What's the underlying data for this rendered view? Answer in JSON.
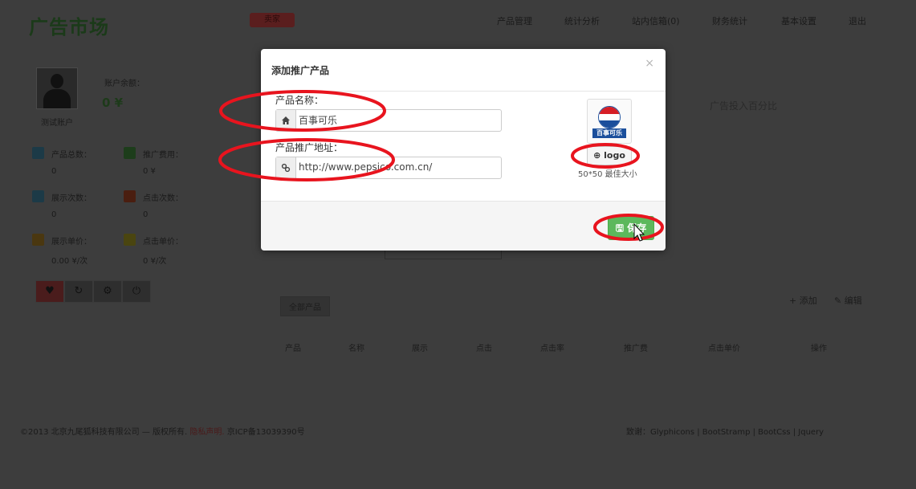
{
  "header": {
    "logo_text": "广告市场",
    "seller_button": "卖家",
    "nav": [
      "产品管理",
      "统计分析",
      "站内信箱(0)",
      "财务统计",
      "基本设置",
      "退出"
    ]
  },
  "sidebar": {
    "user_name": "测试账户",
    "balance_label": "账户余额：",
    "balance_value": "0 ¥",
    "stats": [
      {
        "label": "产品总数：",
        "value": "0",
        "color": "#1c3a47"
      },
      {
        "label": "推广费用：",
        "value": "0 ¥",
        "color": "#1d3d1b"
      },
      {
        "label": "展示次数：",
        "value": "0",
        "color": "#1c3a47"
      },
      {
        "label": "点击次数：",
        "value": "0",
        "color": "#4a1e10"
      },
      {
        "label": "展示单价：",
        "value": "0.00 ¥/次",
        "color": "#4a3710"
      },
      {
        "label": "点击单价：",
        "value": "0 ¥/次",
        "color": "#4a4510"
      }
    ],
    "action_icons": [
      "heart-icon",
      "refresh-icon",
      "gear-icon",
      "power-icon"
    ]
  },
  "main": {
    "ratio_title": "广告投入百分比",
    "tab_all": "全部产品",
    "add_button": "添加",
    "edit_button": "编辑",
    "table_headers": [
      "产品",
      "名称",
      "展示",
      "点击",
      "点击率",
      "推广费",
      "点击单价",
      "操作"
    ]
  },
  "modal": {
    "title": "添加推广产品",
    "close": "×",
    "name_label": "产品名称：",
    "name_value": "百事可乐",
    "url_label": "产品推广地址：",
    "url_value": "http://www.pepsico.com.cn/",
    "logo_image_text": "百事可乐",
    "logo_button": "logo",
    "size_hint": "50*50 最佳大小",
    "save_button": "保存"
  },
  "footer": {
    "copyright_pre": "©2013 北京九尾狐科技有限公司 — 版权所有.",
    "privacy": "隐私声明.",
    "icp": "京ICP备13039390号",
    "credits": "致谢：Glyphicons | BootStramp | BootCss | Jquery"
  },
  "colors": {
    "backdrop": "#3d3d3d",
    "annotation_red": "#e8141e",
    "save_green": "#5cb85c",
    "cursor_highlight": "#ffee00"
  }
}
